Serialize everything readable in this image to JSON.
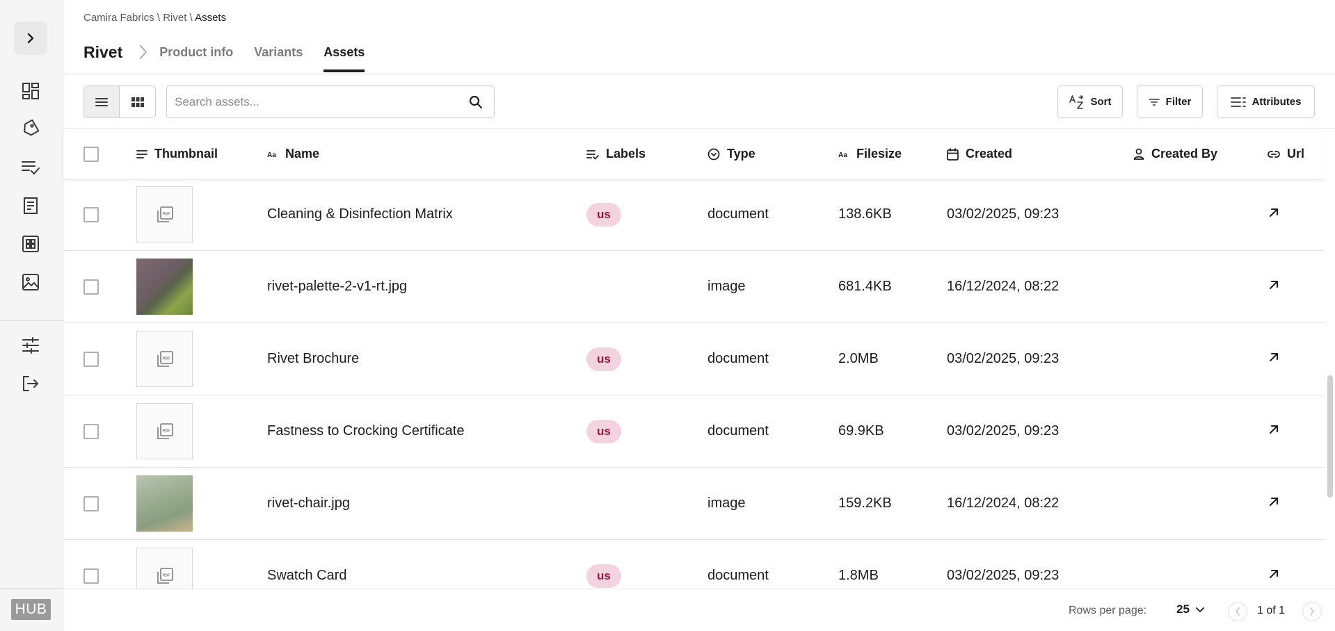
{
  "breadcrumb": {
    "org": "Camira Fabrics",
    "sep1": " \\ ",
    "product": "Rivet",
    "sep2": " \\ ",
    "current": "Assets"
  },
  "title": "Rivet",
  "tabs": [
    {
      "label": "Product info",
      "active": false
    },
    {
      "label": "Variants",
      "active": false
    },
    {
      "label": "Assets",
      "active": true
    }
  ],
  "sidebar": {
    "items": [
      "dashboard-icon",
      "tag-icon",
      "checklist-icon",
      "catalog-icon",
      "grid-icon",
      "image-icon",
      "settings-sliders-icon",
      "logout-icon"
    ],
    "logo": "HUB"
  },
  "toolbar": {
    "search_placeholder": "Search assets...",
    "sort_label": "Sort",
    "filter_label": "Filter",
    "attributes_label": "Attributes"
  },
  "columns": {
    "thumbnail": "Thumbnail",
    "name": "Name",
    "labels": "Labels",
    "type": "Type",
    "filesize": "Filesize",
    "created": "Created",
    "created_by": "Created By",
    "url": "Url"
  },
  "rows": [
    {
      "thumb": "pdf",
      "name": "Cleaning & Disinfection Matrix",
      "label": "us",
      "type": "document",
      "filesize": "138.6KB",
      "created": "03/02/2025, 09:23",
      "created_by": ""
    },
    {
      "thumb": "image",
      "name": "rivet-palette-2-v1-rt.jpg",
      "label": "",
      "type": "image",
      "filesize": "681.4KB",
      "created": "16/12/2024, 08:22",
      "created_by": ""
    },
    {
      "thumb": "pdf",
      "name": "Rivet Brochure",
      "label": "us",
      "type": "document",
      "filesize": "2.0MB",
      "created": "03/02/2025, 09:23",
      "created_by": ""
    },
    {
      "thumb": "pdf",
      "name": "Fastness to Crocking Certificate",
      "label": "us",
      "type": "document",
      "filesize": "69.9KB",
      "created": "03/02/2025, 09:23",
      "created_by": ""
    },
    {
      "thumb": "image",
      "name": "rivet-chair.jpg",
      "label": "",
      "type": "image",
      "filesize": "159.2KB",
      "created": "16/12/2024, 08:22",
      "created_by": ""
    },
    {
      "thumb": "pdf",
      "name": "Swatch Card",
      "label": "us",
      "type": "document",
      "filesize": "1.8MB",
      "created": "03/02/2025, 09:23",
      "created_by": ""
    }
  ],
  "footer": {
    "rows_per_page_label": "Rows per page:",
    "rows_per_page": "25",
    "page_text": "1 of 1"
  }
}
